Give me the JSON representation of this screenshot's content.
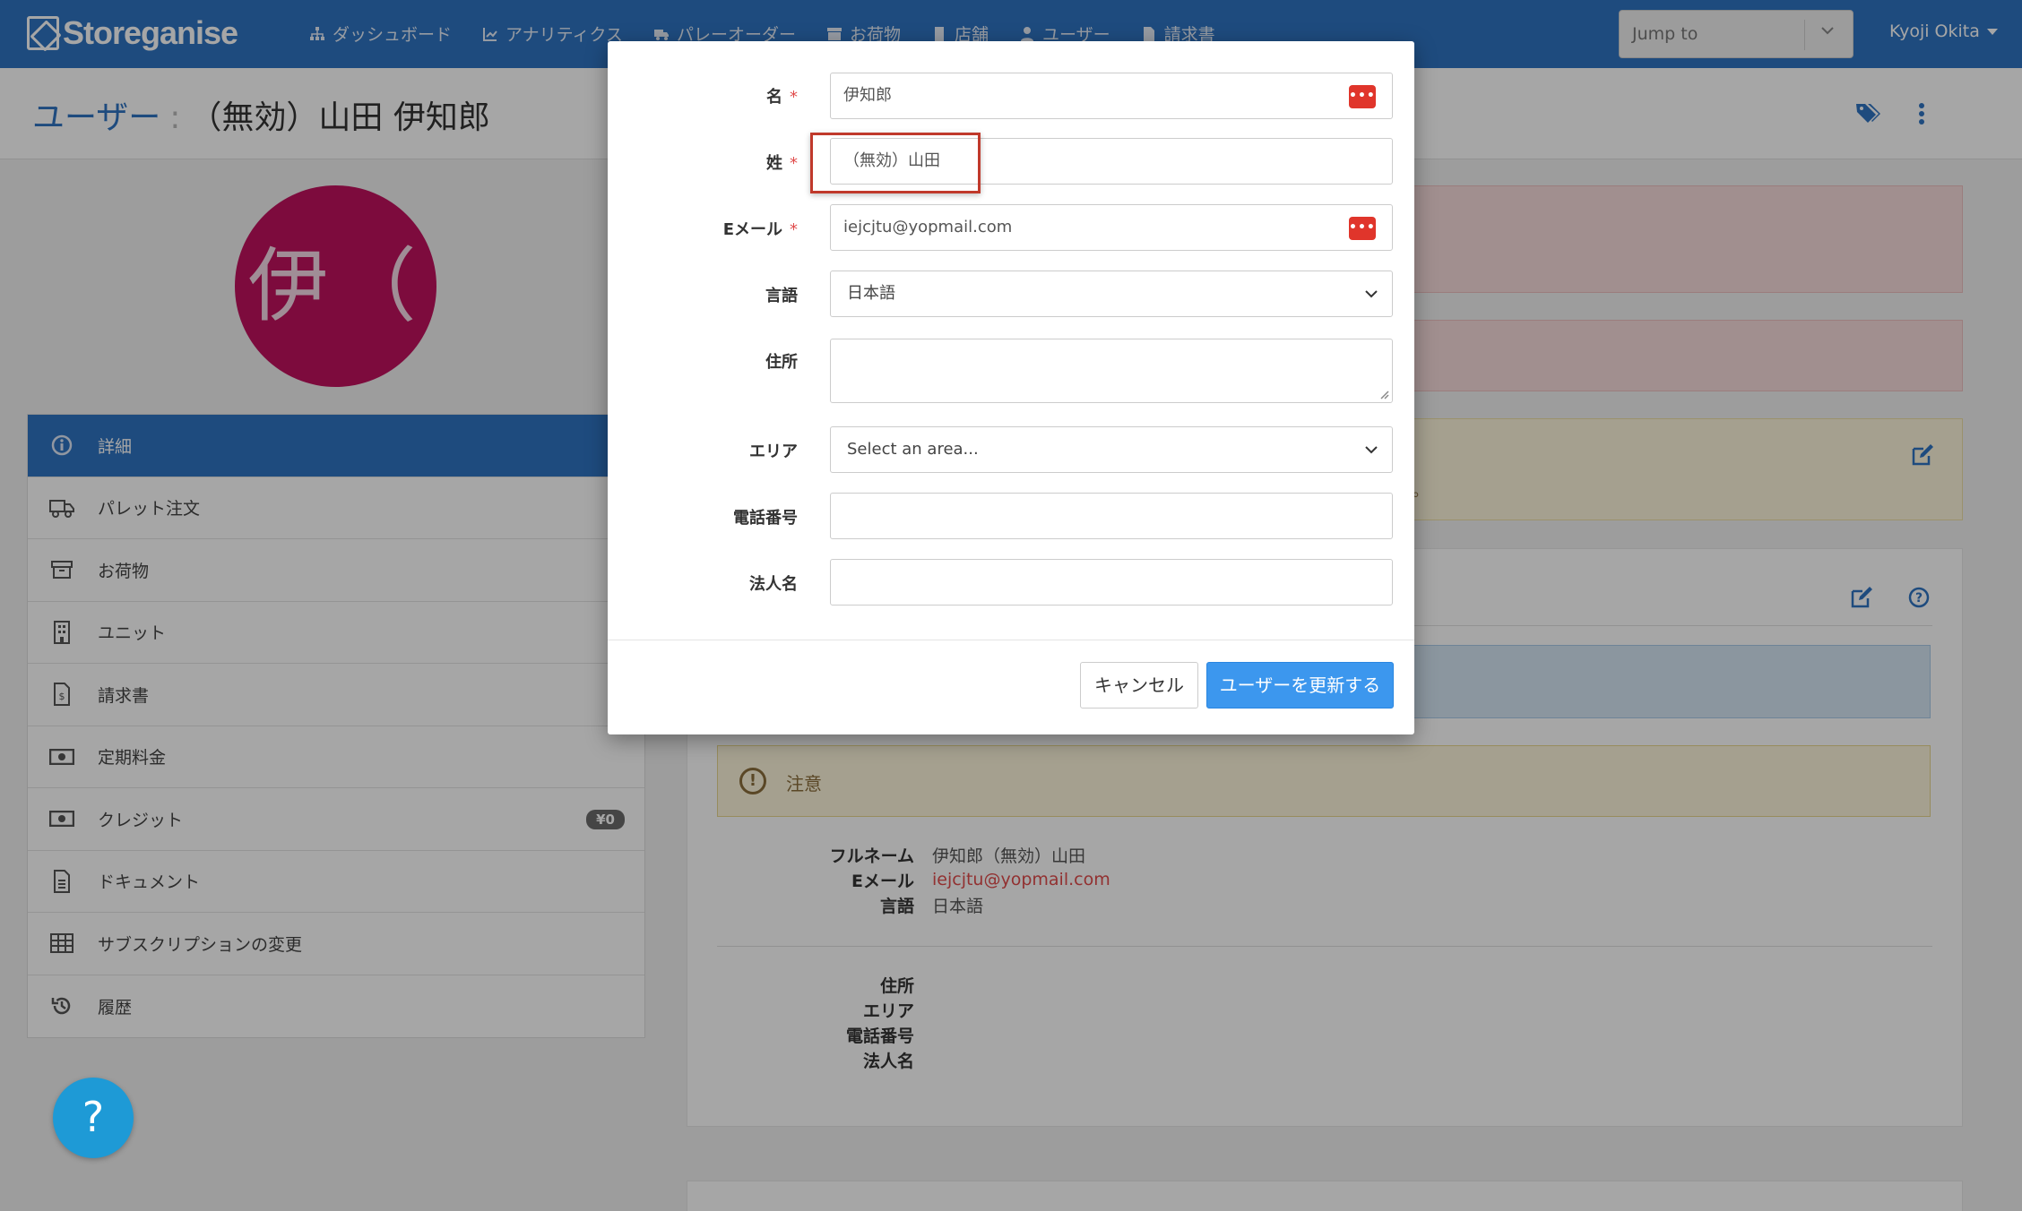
{
  "app": {
    "name": "Storeganise"
  },
  "nav": {
    "items": [
      {
        "label": "ダッシュボード",
        "icon": "sitemap-icon"
      },
      {
        "label": "アナリティクス",
        "icon": "chart-icon"
      },
      {
        "label": "パレーオーダー",
        "icon": "truck-icon"
      },
      {
        "label": "お荷物",
        "icon": "archive-icon"
      },
      {
        "label": "店舗",
        "icon": "building-icon"
      },
      {
        "label": "ユーザー",
        "icon": "user-icon"
      },
      {
        "label": "請求書",
        "icon": "invoice-icon"
      }
    ],
    "jump_placeholder": "Jump to",
    "user_name": "Kyoji Okita"
  },
  "page": {
    "title_prefix": "ユーザー",
    "title_separator": ":",
    "title_name": "（無効）山田 伊知郎",
    "avatar_initials": "伊（"
  },
  "sidebar": {
    "items": [
      {
        "label": "詳細",
        "icon": "info-icon",
        "active": true
      },
      {
        "label": "パレット注文",
        "icon": "truck-icon"
      },
      {
        "label": "お荷物",
        "icon": "archive-icon"
      },
      {
        "label": "ユニット",
        "icon": "building-icon"
      },
      {
        "label": "請求書",
        "icon": "invoice-icon"
      },
      {
        "label": "定期料金",
        "icon": "money-icon"
      },
      {
        "label": "クレジット",
        "icon": "money-icon",
        "badge": "¥0"
      },
      {
        "label": "ドキュメント",
        "icon": "document-icon"
      },
      {
        "label": "サブスクリプションの変更",
        "icon": "table-icon"
      },
      {
        "label": "履歴",
        "icon": "history-icon"
      }
    ]
  },
  "help": {
    "label": "?"
  },
  "content": {
    "alert_tail": "。",
    "note_label": "注意",
    "details": [
      {
        "key": "フルネーム",
        "value": "伊知郎（無効）山田"
      },
      {
        "key": "Eメール",
        "value": "iejcjtu@yopmail.com",
        "link": true
      },
      {
        "key": "言語",
        "value": "日本語"
      }
    ],
    "details2": [
      {
        "key": "住所",
        "value": ""
      },
      {
        "key": "エリア",
        "value": ""
      },
      {
        "key": "電話番号",
        "value": ""
      },
      {
        "key": "法人名",
        "value": ""
      }
    ]
  },
  "modal": {
    "fields": {
      "first_name": {
        "label": "名",
        "value": "伊知郎",
        "required": true
      },
      "last_name": {
        "label": "姓",
        "value": "（無効）山田",
        "required": true
      },
      "email": {
        "label": "Eメール",
        "value": "iejcjtu@yopmail.com",
        "required": true
      },
      "language": {
        "label": "言語",
        "value": "日本語"
      },
      "address": {
        "label": "住所",
        "value": ""
      },
      "area": {
        "label": "エリア",
        "value": "Select an area..."
      },
      "phone": {
        "label": "電話番号",
        "value": ""
      },
      "company": {
        "label": "法人名",
        "value": ""
      }
    },
    "required_marker": "*",
    "pw_icon_text": "•••|",
    "cancel_label": "キャンセル",
    "update_label": "ユーザーを更新する"
  },
  "colors": {
    "brand": "#2f73c2",
    "avatar": "#c0125e",
    "danger": "#e04c4c",
    "primary_button": "#3c97ee"
  }
}
